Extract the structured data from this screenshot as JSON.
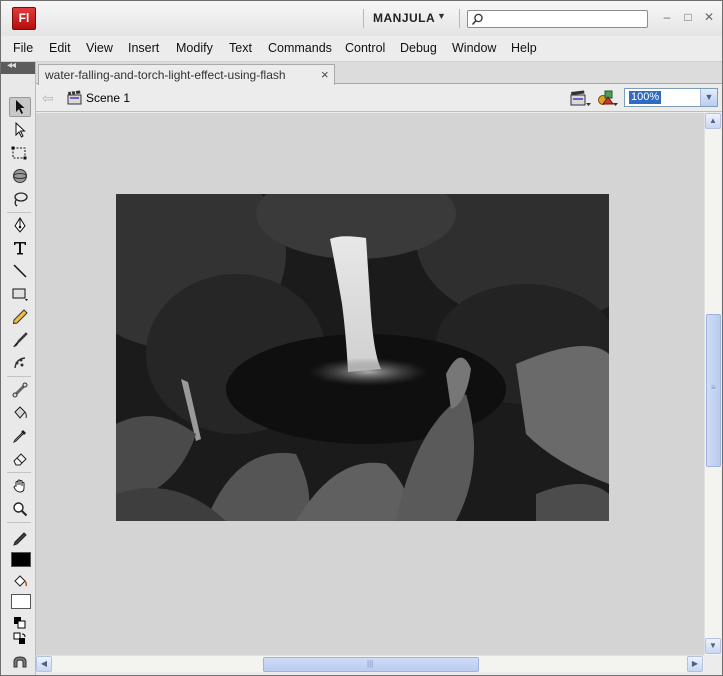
{
  "app": {
    "logo_text": "Fl",
    "workspace": "MANJULA",
    "search": {
      "placeholder": "",
      "value": ""
    },
    "accent_color": "#c8201e"
  },
  "menu": [
    "File",
    "Edit",
    "View",
    "Insert",
    "Modify",
    "Text",
    "Commands",
    "Control",
    "Debug",
    "Window",
    "Help"
  ],
  "document_tab": {
    "title": "water-falling-and-torch-light-effect-using-flash",
    "close_glyph": "×"
  },
  "edit_bar": {
    "scene": "Scene 1",
    "zoom": "100%"
  },
  "tools": [
    "selection-tool",
    "subselection-tool",
    "free-transform-tool",
    "3d-rotation-tool",
    "lasso-tool",
    "pen-tool",
    "text-tool",
    "line-tool",
    "rectangle-tool",
    "pencil-tool",
    "brush-tool",
    "deco-tool",
    "bone-tool",
    "paint-bucket-tool",
    "eyedropper-tool",
    "eraser-tool",
    "hand-tool",
    "zoom-tool"
  ],
  "colors": {
    "stroke": "#000000",
    "fill": "#ffffff",
    "stage_background": "#d4d4d4"
  },
  "stage_image": {
    "subject": "waterfall-jungle-photo"
  }
}
